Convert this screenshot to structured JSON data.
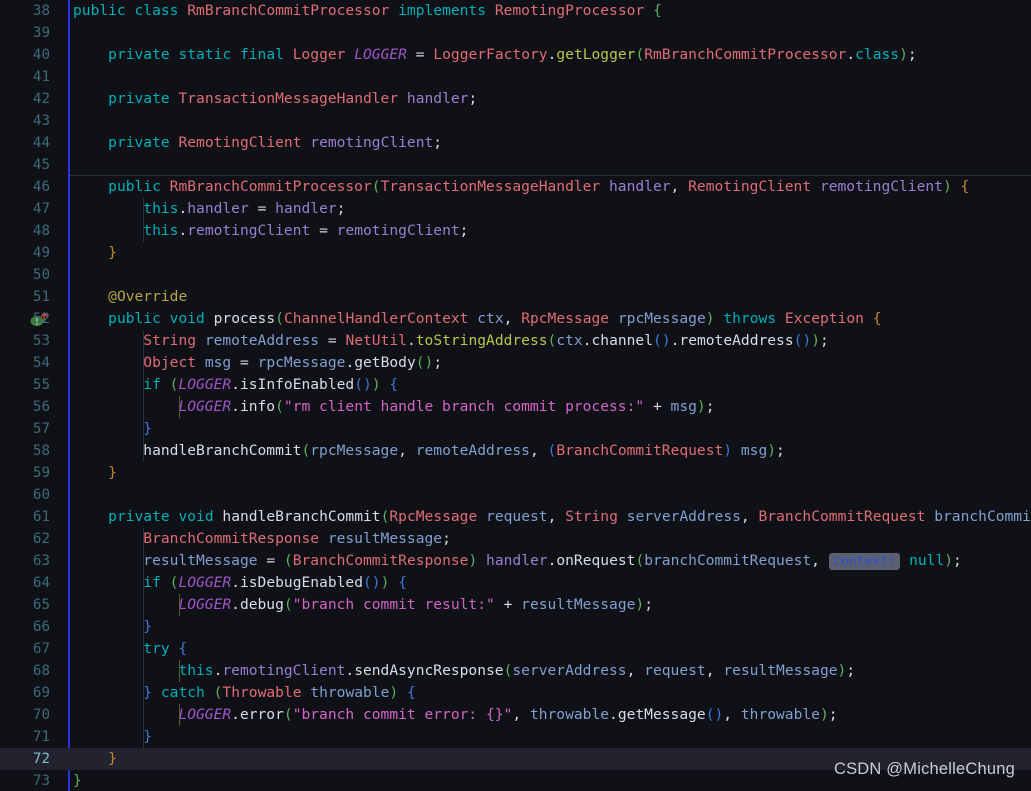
{
  "editor": {
    "first_line_number": 38,
    "last_line_number": 73,
    "current_line": 72,
    "background_color": "#0f1117",
    "current_line_color": "#232330",
    "line_number_color": "#3c6b78",
    "fold_bar_color": "#2a32dd"
  },
  "gutter": {
    "icons": [
      {
        "line": 52,
        "name": "implementing-method-icon",
        "glyph": "I",
        "arrow": "↑",
        "color": "#3a7d3a",
        "arrow_color": "#d04a4a"
      }
    ]
  },
  "watermark": {
    "text": "CSDN @MichelleChung"
  },
  "inline_hints": [
    {
      "line": 63,
      "text": "context:",
      "background": "#5a6070",
      "color": "#2f4fcf"
    }
  ],
  "code": {
    "language": "Java",
    "class_name": "RmBranchCommitProcessor",
    "lines": [
      {
        "n": 38,
        "text": "public class RmBranchCommitProcessor implements RemotingProcessor {"
      },
      {
        "n": 39,
        "text": ""
      },
      {
        "n": 40,
        "text": "    private static final Logger LOGGER = LoggerFactory.getLogger(RmBranchCommitProcessor.class);"
      },
      {
        "n": 41,
        "text": ""
      },
      {
        "n": 42,
        "text": "    private TransactionMessageHandler handler;"
      },
      {
        "n": 43,
        "text": ""
      },
      {
        "n": 44,
        "text": "    private RemotingClient remotingClient;"
      },
      {
        "n": 45,
        "text": ""
      },
      {
        "n": 46,
        "text": "    public RmBranchCommitProcessor(TransactionMessageHandler handler, RemotingClient remotingClient) {"
      },
      {
        "n": 47,
        "text": "        this.handler = handler;"
      },
      {
        "n": 48,
        "text": "        this.remotingClient = remotingClient;"
      },
      {
        "n": 49,
        "text": "    }"
      },
      {
        "n": 50,
        "text": ""
      },
      {
        "n": 51,
        "text": "    @Override"
      },
      {
        "n": 52,
        "text": "    public void process(ChannelHandlerContext ctx, RpcMessage rpcMessage) throws Exception {"
      },
      {
        "n": 53,
        "text": "        String remoteAddress = NetUtil.toStringAddress(ctx.channel().remoteAddress());"
      },
      {
        "n": 54,
        "text": "        Object msg = rpcMessage.getBody();"
      },
      {
        "n": 55,
        "text": "        if (LOGGER.isInfoEnabled()) {"
      },
      {
        "n": 56,
        "text": "            LOGGER.info(\"rm client handle branch commit process:\" + msg);"
      },
      {
        "n": 57,
        "text": "        }"
      },
      {
        "n": 58,
        "text": "        handleBranchCommit(rpcMessage, remoteAddress, (BranchCommitRequest) msg);"
      },
      {
        "n": 59,
        "text": "    }"
      },
      {
        "n": 60,
        "text": ""
      },
      {
        "n": 61,
        "text": "    private void handleBranchCommit(RpcMessage request, String serverAddress, BranchCommitRequest branchCommitRequest) {"
      },
      {
        "n": 62,
        "text": "        BranchCommitResponse resultMessage;"
      },
      {
        "n": 63,
        "text": "        resultMessage = (BranchCommitResponse) handler.onRequest(branchCommitRequest, context: null);"
      },
      {
        "n": 64,
        "text": "        if (LOGGER.isDebugEnabled()) {"
      },
      {
        "n": 65,
        "text": "            LOGGER.debug(\"branch commit result:\" + resultMessage);"
      },
      {
        "n": 66,
        "text": "        }"
      },
      {
        "n": 67,
        "text": "        try {"
      },
      {
        "n": 68,
        "text": "            this.remotingClient.sendAsyncResponse(serverAddress, request, resultMessage);"
      },
      {
        "n": 69,
        "text": "        } catch (Throwable throwable) {"
      },
      {
        "n": 70,
        "text": "            LOGGER.error(\"branch commit error: {}\", throwable.getMessage(), throwable);"
      },
      {
        "n": 71,
        "text": "        }"
      },
      {
        "n": 72,
        "text": "    }"
      },
      {
        "n": 73,
        "text": "}"
      }
    ]
  }
}
